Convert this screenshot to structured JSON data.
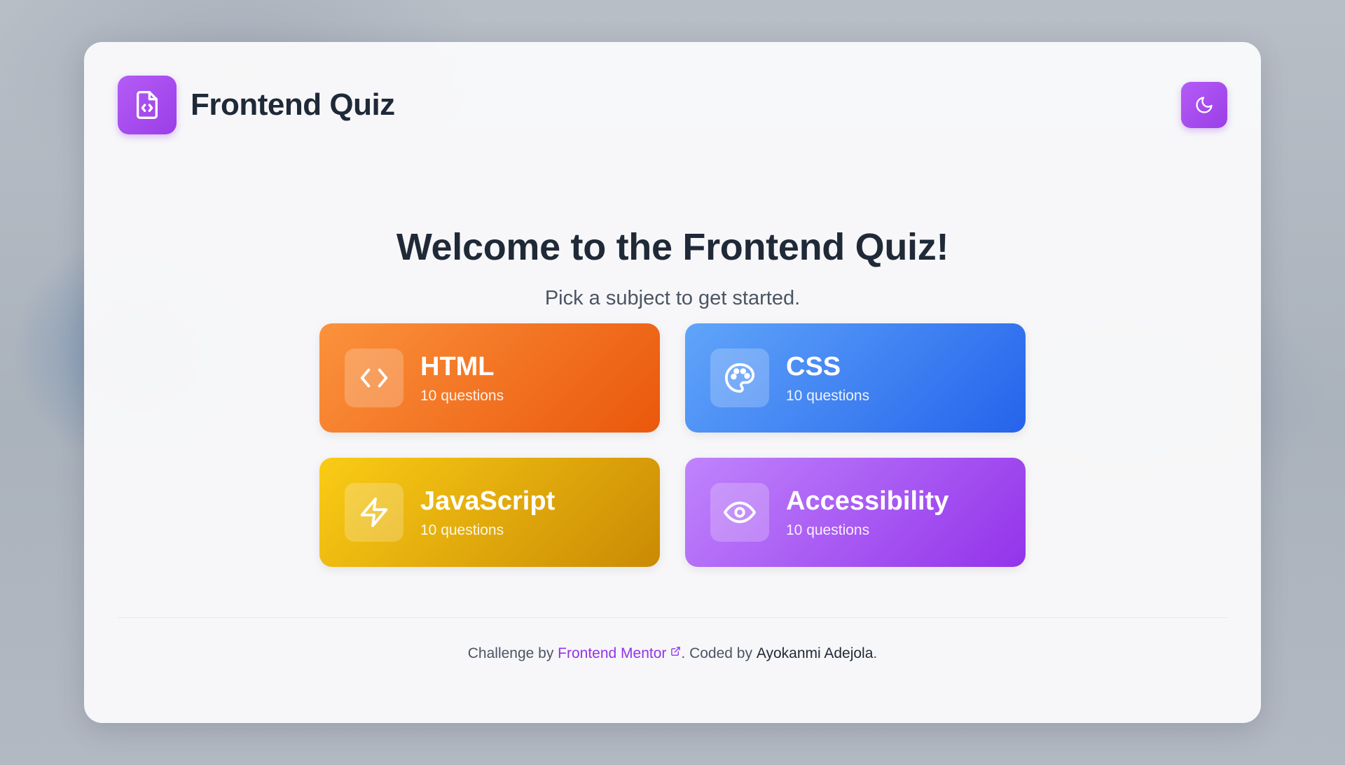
{
  "header": {
    "app_title": "Frontend Quiz",
    "logo_icon": "file-code-icon",
    "theme_toggle_icon": "moon-icon"
  },
  "hero": {
    "title": "Welcome to the Frontend Quiz!",
    "subtitle": "Pick a subject to get started."
  },
  "subjects": [
    {
      "name": "HTML",
      "count_label": "10 questions",
      "icon": "code-icon",
      "color": "#ea580c"
    },
    {
      "name": "CSS",
      "count_label": "10 questions",
      "icon": "palette-icon",
      "color": "#2563eb"
    },
    {
      "name": "JavaScript",
      "count_label": "10 questions",
      "icon": "lightning-icon",
      "color": "#ca8a04"
    },
    {
      "name": "Accessibility",
      "count_label": "10 questions",
      "icon": "eye-icon",
      "color": "#9333ea"
    }
  ],
  "footer": {
    "prefix": "Challenge by ",
    "link_text": "Frontend Mentor",
    "middle": ". Coded by ",
    "author": "Ayokanmi Adejola",
    "suffix": "."
  },
  "colors": {
    "accent": "#9b3ee8",
    "text_dark": "#1f2937",
    "link": "#9333ea"
  }
}
